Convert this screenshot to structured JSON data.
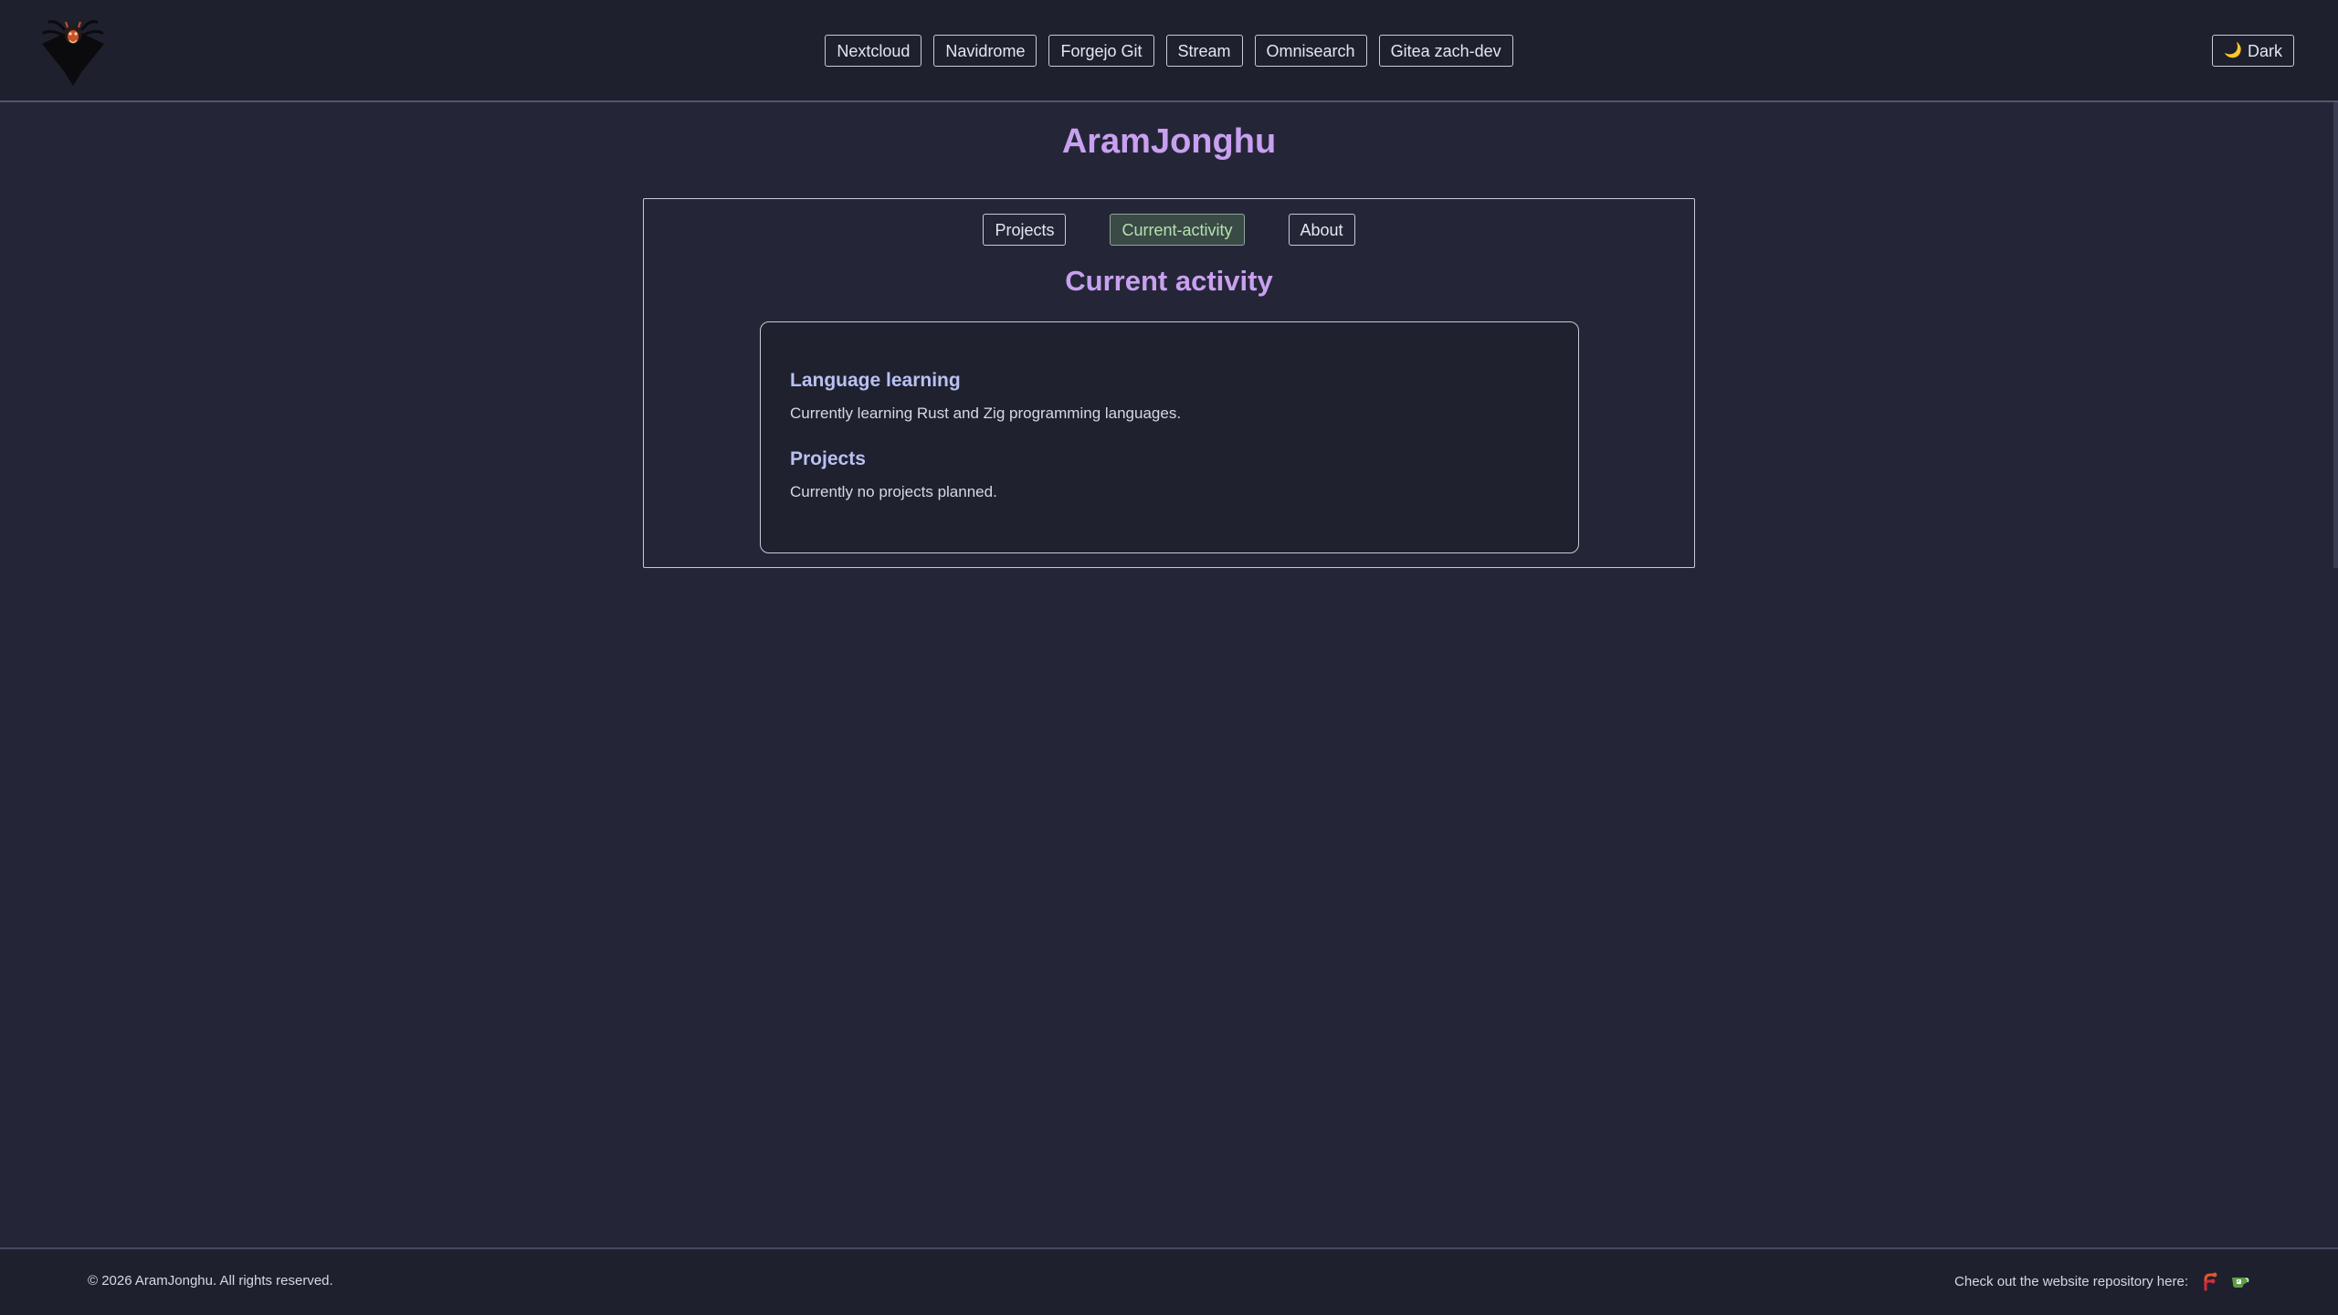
{
  "header": {
    "links": [
      "Nextcloud",
      "Navidrome",
      "Forgejo Git",
      "Stream",
      "Omnisearch",
      "Gitea zach-dev"
    ],
    "theme_toggle": {
      "icon": "moon-icon",
      "label": "Dark"
    },
    "logo_icon": "spider-logo-icon"
  },
  "site_title": "AramJonghu",
  "tabs": [
    {
      "label": "Projects",
      "active": false
    },
    {
      "label": "Current-activity",
      "active": true
    },
    {
      "label": "About",
      "active": false
    }
  ],
  "section_title": "Current activity",
  "content": [
    {
      "heading": "Language learning",
      "text": "Currently learning Rust and Zig programming languages."
    },
    {
      "heading": "Projects",
      "text": "Currently no projects planned."
    }
  ],
  "footer": {
    "copyright": "© 2026 AramJonghu. All rights reserved.",
    "repo_text": "Check out the website repository here:",
    "repo_icons": [
      "forgejo-icon",
      "gitea-icon"
    ]
  },
  "colors": {
    "background": "#242638",
    "bar": "#1e202d",
    "accent_title": "#c9a0f0",
    "heading": "#b9c1f2",
    "active_tab_bg": "#3a4a45",
    "active_tab_text": "#b5e0b0"
  }
}
